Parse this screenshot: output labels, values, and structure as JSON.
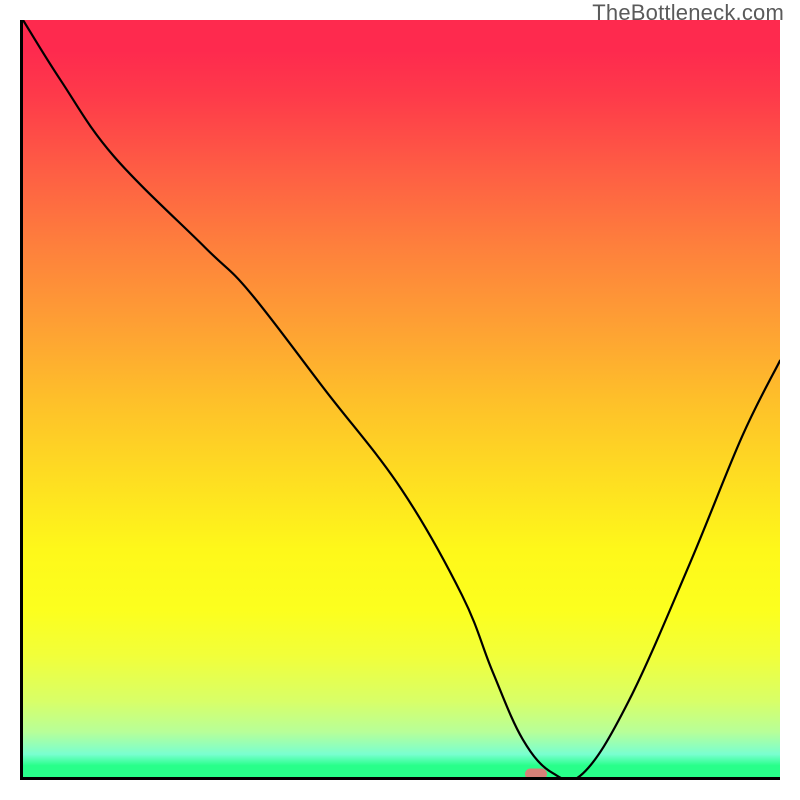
{
  "watermark": "TheBottleneck.com",
  "chart_data": {
    "type": "line",
    "title": "",
    "xlabel": "",
    "ylabel": "",
    "xlim": [
      0,
      100
    ],
    "ylim": [
      0,
      100
    ],
    "grid": false,
    "legend": false,
    "background_gradient": {
      "direction": "vertical",
      "stops": [
        {
          "pct": 0,
          "color": "#fe2a4e"
        },
        {
          "pct": 50,
          "color": "#febf2a"
        },
        {
          "pct": 78,
          "color": "#fcff1e"
        },
        {
          "pct": 100,
          "color": "#28ff8a"
        }
      ]
    },
    "series": [
      {
        "name": "bottleneck-curve",
        "color": "#000000",
        "x": [
          0,
          5,
          12,
          24,
          30,
          40,
          50,
          58,
          62,
          66,
          70,
          74,
          80,
          88,
          95,
          100
        ],
        "y": [
          100,
          92,
          82,
          70,
          64,
          51,
          38,
          24,
          14,
          5,
          0.5,
          0.5,
          10,
          28,
          45,
          55
        ]
      }
    ],
    "marker": {
      "name": "optimal-point",
      "x": 67.5,
      "y": 0.8,
      "color": "#d68178"
    }
  }
}
